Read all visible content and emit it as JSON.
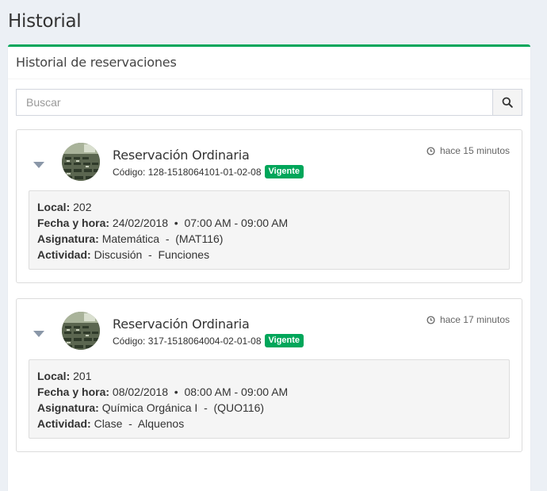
{
  "page": {
    "title": "Historial"
  },
  "panel": {
    "title": "Historial de reservaciones"
  },
  "search": {
    "placeholder": "Buscar",
    "value": ""
  },
  "colors": {
    "accent": "#00a65a",
    "badge": "#00a65a"
  },
  "reservations": [
    {
      "title": "Reservación Ordinaria",
      "code_label": "Código:",
      "code": "128-1518064101-01-02-08",
      "status": "Vigente",
      "time": "hace 15 minutos",
      "local_label": "Local:",
      "local": "202",
      "fecha_label": "Fecha y hora:",
      "fecha": "24/02/2018",
      "sep": "•",
      "hora": "07:00 AM - 09:00 AM",
      "asignatura_label": "Asignatura:",
      "asignatura": "Matemática  -  (MAT116)",
      "actividad_label": "Actividad:",
      "actividad": "Discusión  -  Funciones"
    },
    {
      "title": "Reservación Ordinaria",
      "code_label": "Código:",
      "code": "317-1518064004-02-01-08",
      "status": "Vigente",
      "time": "hace 17 minutos",
      "local_label": "Local:",
      "local": "201",
      "fecha_label": "Fecha y hora:",
      "fecha": "08/02/2018",
      "sep": "•",
      "hora": "08:00 AM - 09:00 AM",
      "asignatura_label": "Asignatura:",
      "asignatura": "Química Orgánica I  -  (QUO116)",
      "actividad_label": "Actividad:",
      "actividad": "Clase  -  Alquenos"
    }
  ]
}
